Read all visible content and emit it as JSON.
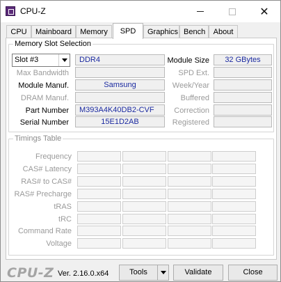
{
  "window": {
    "title": "CPU-Z"
  },
  "tabs": [
    {
      "label": "CPU"
    },
    {
      "label": "Mainboard"
    },
    {
      "label": "Memory"
    },
    {
      "label": "SPD"
    },
    {
      "label": "Graphics"
    },
    {
      "label": "Bench"
    },
    {
      "label": "About"
    }
  ],
  "active_tab": "SPD",
  "slot_group": {
    "title": "Memory Slot Selection",
    "slot_select": "Slot #3",
    "memory_type": "DDR4",
    "module_size_label": "Module Size",
    "module_size": "32 GBytes",
    "labels": {
      "max_bandwidth": "Max Bandwidth",
      "module_manuf": "Module Manuf.",
      "dram_manuf": "DRAM Manuf.",
      "part_number": "Part Number",
      "serial_number": "Serial Number",
      "spd_ext": "SPD Ext.",
      "week_year": "Week/Year",
      "buffered": "Buffered",
      "correction": "Correction",
      "registered": "Registered"
    },
    "values": {
      "max_bandwidth": "",
      "module_manuf": "Samsung",
      "dram_manuf": "",
      "part_number": "M393A4K40DB2-CVF",
      "serial_number": "15E1D2AB",
      "spd_ext": "",
      "week_year": "",
      "buffered": "",
      "correction": "",
      "registered": ""
    }
  },
  "timings": {
    "title": "Timings Table",
    "rows": [
      "Frequency",
      "CAS# Latency",
      "RAS# to CAS#",
      "RAS# Precharge",
      "tRAS",
      "tRC",
      "Command Rate",
      "Voltage"
    ]
  },
  "footer": {
    "brand": "CPU-Z",
    "version": "Ver. 2.16.0.x64",
    "tools_label": "Tools",
    "validate_label": "Validate",
    "close_label": "Close"
  }
}
